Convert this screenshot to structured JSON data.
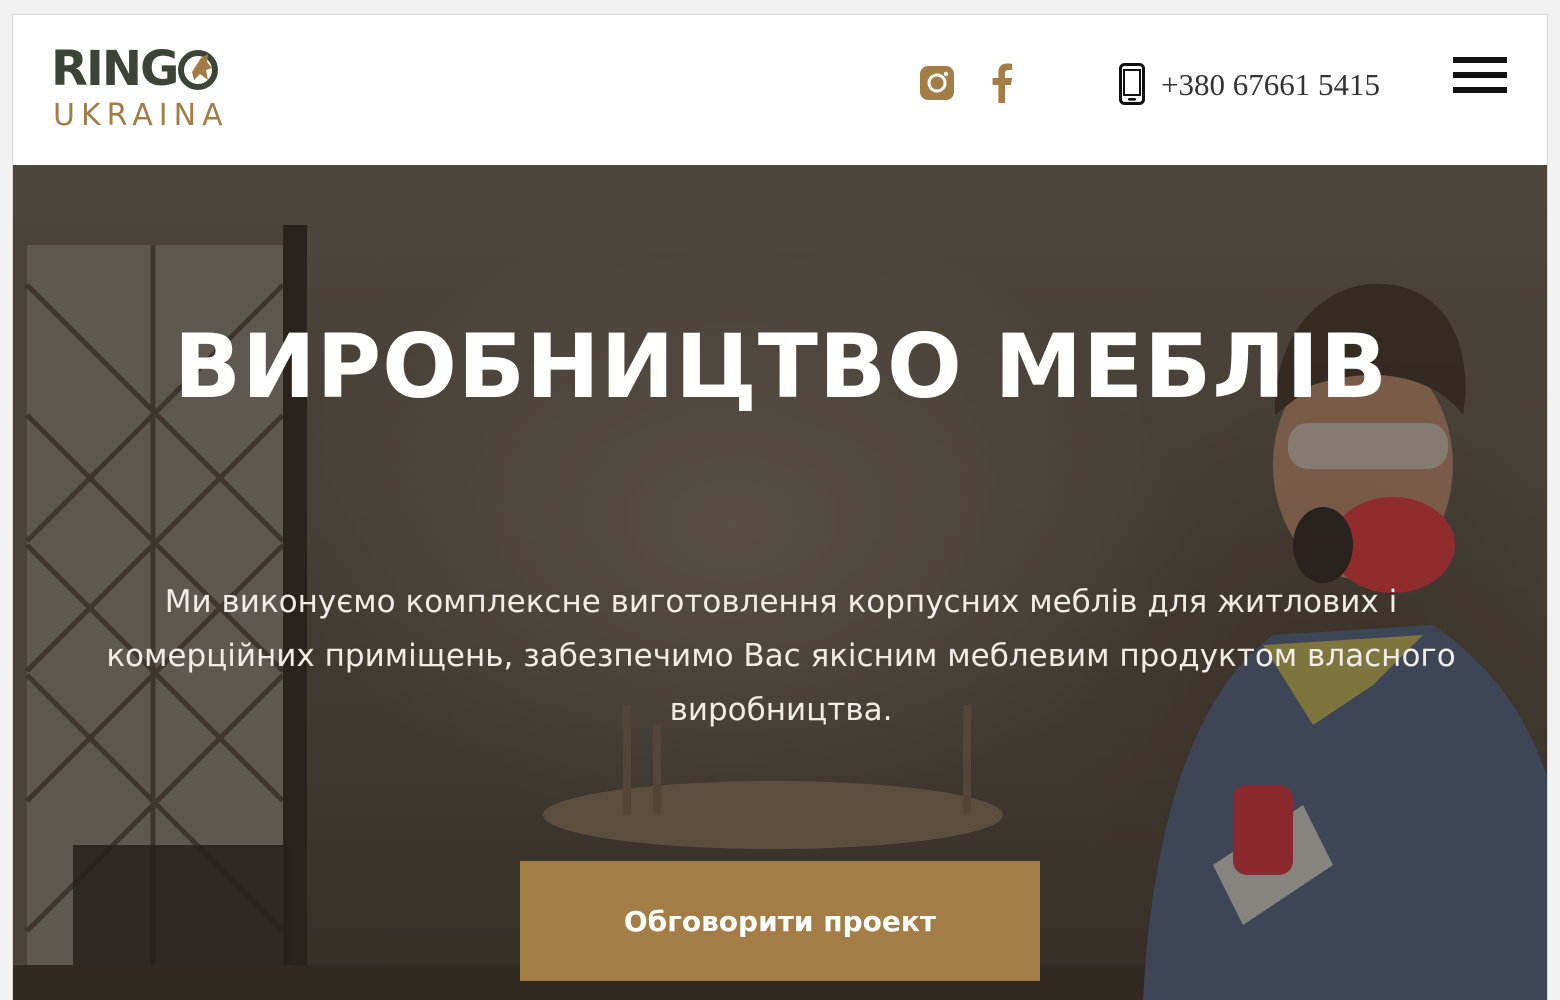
{
  "brand": {
    "name": "RINGO",
    "name_prefix": "RING",
    "subtitle": "UKRAINA",
    "dark_color": "#3b4436",
    "accent_color": "#a47d46"
  },
  "header": {
    "social": [
      {
        "name": "instagram",
        "icon": "instagram-icon"
      },
      {
        "name": "facebook",
        "icon": "facebook-icon"
      }
    ],
    "phone": {
      "icon": "mobile-phone-icon",
      "number": "+380 67661 5415"
    },
    "menu_icon": "hamburger-menu-icon"
  },
  "hero": {
    "title": "ВИРОБНИЦТВО МЕБЛІВ",
    "description": "Ми виконуємо комплексне виготовлення корпусних меблів для житлових і комерційних приміщень, забезпечимо Вас якісним меблевим продуктом власного виробництва.",
    "cta_label": "Обговорити проект",
    "cta_color": "#a47d46",
    "background": "carpenter working with a hand saw in a workshop"
  }
}
